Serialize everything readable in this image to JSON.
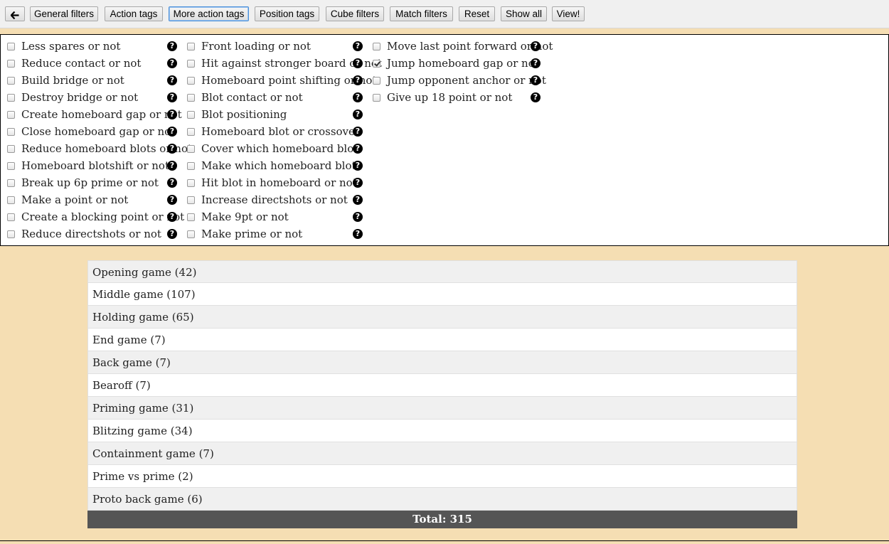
{
  "toolbar": {
    "back_icon": "arrow-left-icon",
    "buttons": [
      {
        "label": "General filters",
        "active": false
      },
      {
        "label": "Action tags",
        "active": false
      },
      {
        "label": "More action tags",
        "active": true
      },
      {
        "label": "Position tags",
        "active": false
      },
      {
        "label": "Cube filters",
        "active": false
      },
      {
        "label": "Match filters",
        "active": false
      },
      {
        "label": "Reset",
        "active": false
      },
      {
        "label": "Show all",
        "active": false
      },
      {
        "label": "View!",
        "active": false
      }
    ]
  },
  "tags": {
    "help_glyph": "?",
    "columns": [
      [
        {
          "label": "Less spares or not",
          "checked": false
        },
        {
          "label": "Reduce contact or not",
          "checked": false
        },
        {
          "label": "Build bridge or not",
          "checked": false
        },
        {
          "label": "Destroy bridge or not",
          "checked": false
        },
        {
          "label": "Create homeboard gap or not",
          "checked": false
        },
        {
          "label": "Close homeboard gap or not",
          "checked": false
        },
        {
          "label": "Reduce homeboard blots or not",
          "checked": false
        },
        {
          "label": "Homeboard blotshift or not",
          "checked": false
        },
        {
          "label": "Break up 6p prime or not",
          "checked": false
        },
        {
          "label": "Make a point or not",
          "checked": false
        },
        {
          "label": "Create a blocking point or not",
          "checked": false
        },
        {
          "label": "Reduce directshots or not",
          "checked": false
        }
      ],
      [
        {
          "label": "Front loading or not",
          "checked": false
        },
        {
          "label": "Hit against stronger board or not",
          "checked": false
        },
        {
          "label": "Homeboard point shifting or not",
          "checked": false
        },
        {
          "label": "Blot contact or not",
          "checked": false
        },
        {
          "label": "Blot positioning",
          "checked": false
        },
        {
          "label": "Homeboard blot or crossover",
          "checked": false
        },
        {
          "label": "Cover which homeboard blot",
          "checked": false
        },
        {
          "label": "Make which homeboard blot",
          "checked": false
        },
        {
          "label": "Hit blot in homeboard or not",
          "checked": false
        },
        {
          "label": "Increase directshots or not",
          "checked": false
        },
        {
          "label": "Make 9pt or not",
          "checked": false
        },
        {
          "label": "Make prime or not",
          "checked": false
        }
      ],
      [
        {
          "label": "Move last point forward or not",
          "checked": false
        },
        {
          "label": "Jump homeboard gap or not",
          "checked": true
        },
        {
          "label": "Jump opponent anchor or not",
          "checked": false
        },
        {
          "label": "Give up 18 point or not",
          "checked": false
        }
      ]
    ]
  },
  "categories": [
    {
      "label": "Opening game (42)"
    },
    {
      "label": "Middle game (107)"
    },
    {
      "label": "Holding game (65)"
    },
    {
      "label": "End game (7)"
    },
    {
      "label": "Back game (7)"
    },
    {
      "label": "Bearoff (7)"
    },
    {
      "label": "Priming game (31)"
    },
    {
      "label": "Blitzing game (34)"
    },
    {
      "label": "Containment game (7)"
    },
    {
      "label": "Prime vs prime (2)"
    },
    {
      "label": "Proto back game (6)"
    }
  ],
  "total": "Total: 315",
  "colors": {
    "page_background": "#f5deb3",
    "total_bar": "#555555",
    "active_button_border": "#4a8fd9"
  }
}
